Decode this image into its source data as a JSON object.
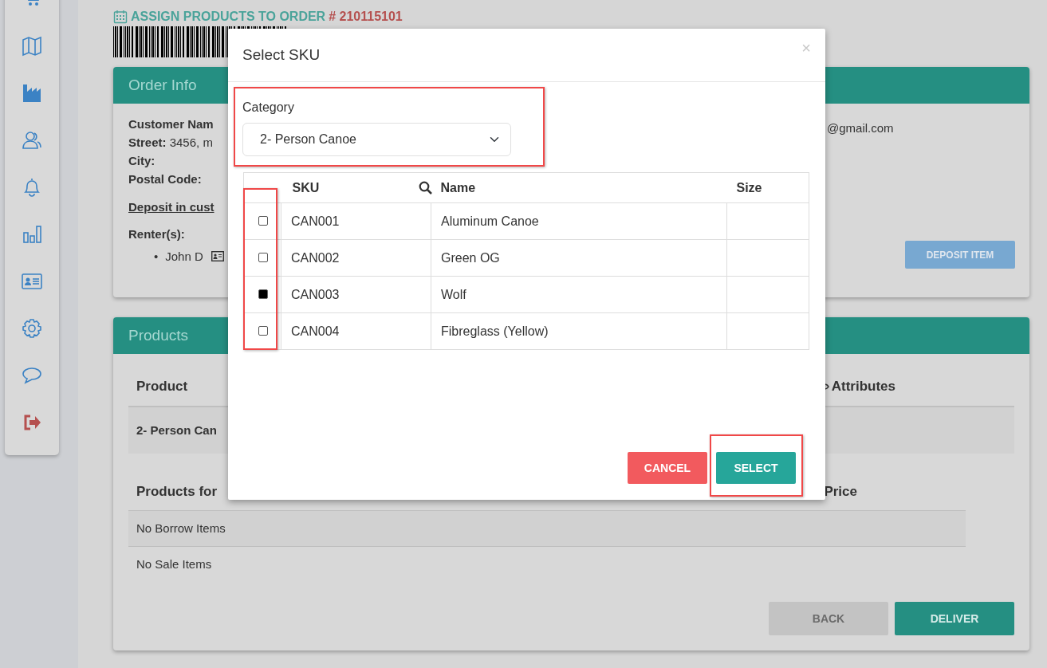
{
  "sidebar": {
    "items": [
      {
        "kind": "cart"
      },
      {
        "kind": "map"
      },
      {
        "kind": "factory"
      },
      {
        "kind": "users"
      },
      {
        "kind": "bell"
      },
      {
        "kind": "chart"
      },
      {
        "kind": "idcard"
      },
      {
        "kind": "gear"
      },
      {
        "kind": "comment"
      },
      {
        "kind": "logout"
      }
    ]
  },
  "heading": {
    "title": "ASSIGN PRODUCTS TO ORDER",
    "order_number": "# 210115101"
  },
  "order_info": {
    "title": "Order Info",
    "fields": [
      {
        "label": "Customer Nam"
      },
      {
        "label": "Street:",
        "value": "3456, m"
      },
      {
        "label": "City:"
      },
      {
        "label": "Postal Code:"
      }
    ],
    "email": "@gmail.com",
    "deposit_link": "Deposit in cust",
    "renters_label": "Renter(s):",
    "renters": [
      {
        "bullet": "•",
        "name": "John D"
      }
    ],
    "deposit_button": "DEPOSIT ITEM"
  },
  "products": {
    "title": "Products",
    "columns": [
      "Product",
      "Attributes"
    ],
    "rows": [
      "2- Person Can"
    ],
    "items_columns": [
      "Products for",
      "Price"
    ],
    "items_rows": [
      "No Borrow Items",
      "No Sale Items"
    ],
    "buttons": [
      {
        "label": "BACK",
        "kind": "secondary"
      },
      {
        "label": "DELIVER",
        "kind": "primary"
      }
    ]
  },
  "modal": {
    "title": "Select SKU",
    "close": "×",
    "category_label": "Category",
    "category_value": "2- Person Canoe",
    "columns": [
      "SKU",
      "Name",
      "Size"
    ],
    "rows": [
      {
        "sku": "CAN001",
        "name": "Aluminum Canoe",
        "checked": false
      },
      {
        "sku": "CAN002",
        "name": "Green OG",
        "checked": false
      },
      {
        "sku": "CAN003",
        "name": "Wolf",
        "checked": true
      },
      {
        "sku": "CAN004",
        "name": "Fibreglass (Yellow)",
        "checked": false
      }
    ],
    "buttons": [
      {
        "label": "CANCEL",
        "kind": "danger"
      },
      {
        "label": "SELECT",
        "kind": "primary"
      }
    ]
  }
}
